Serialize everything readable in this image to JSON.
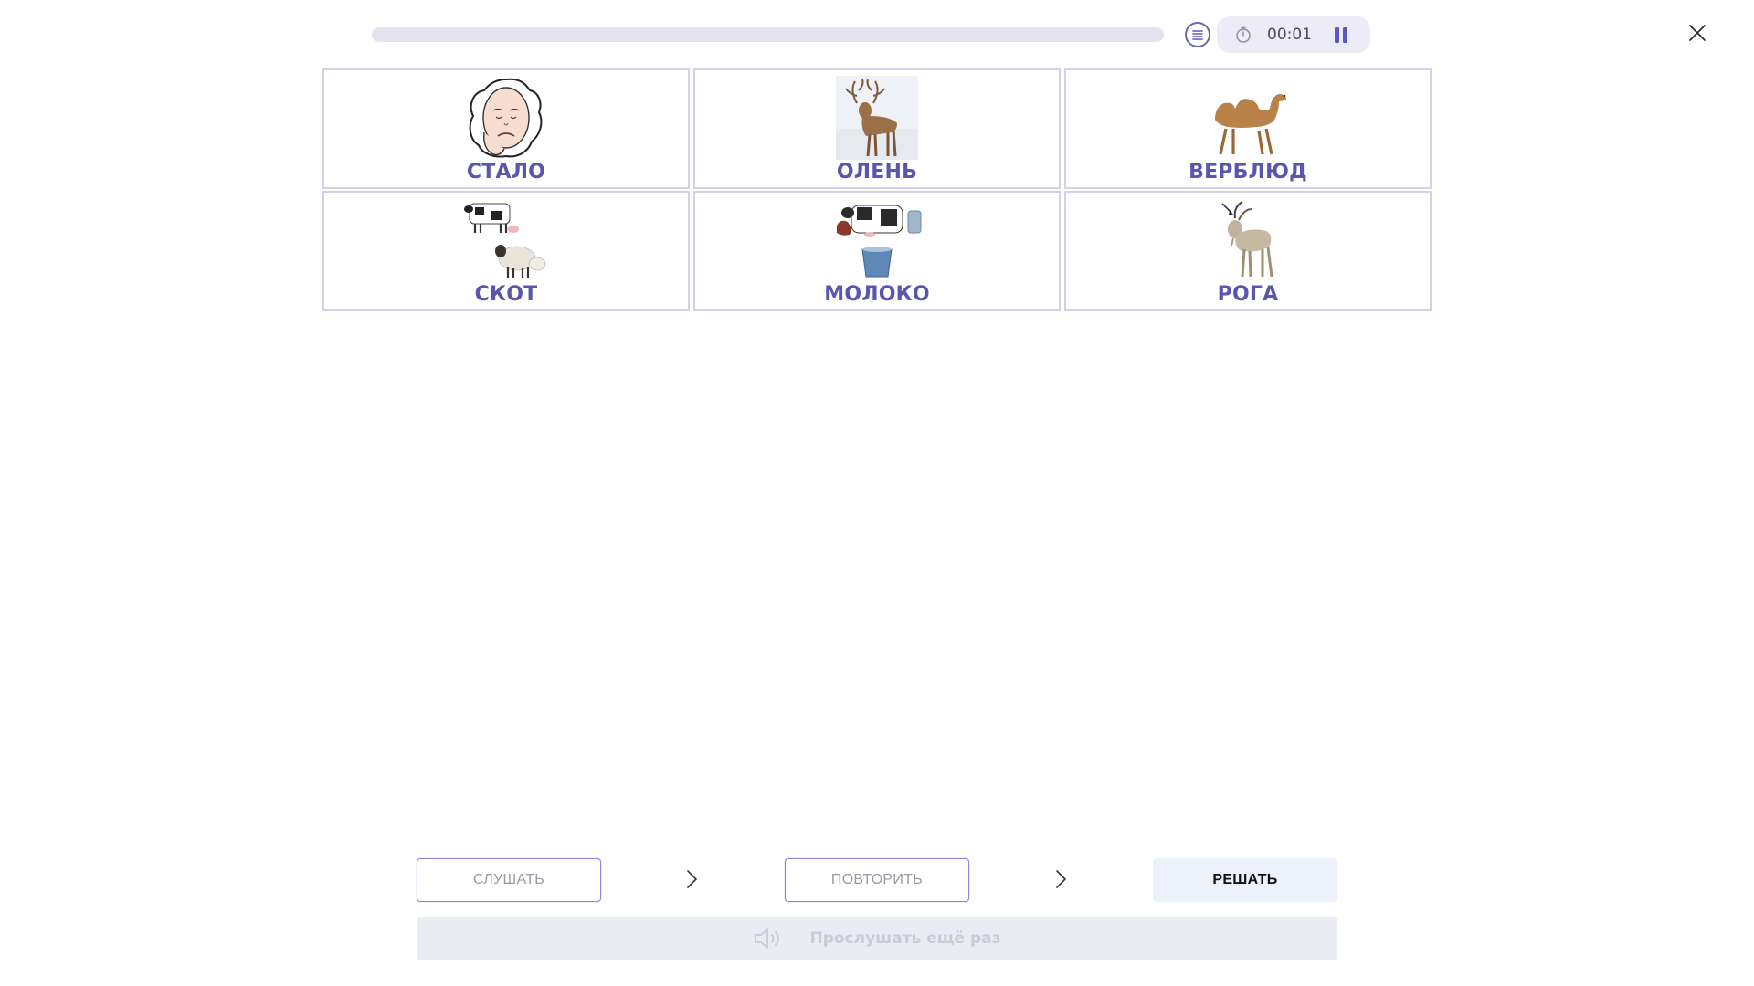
{
  "header": {
    "progress": 0,
    "timer": "00:01"
  },
  "cards": [
    {
      "label": "СТАЛО",
      "icon": "sad-face-icon"
    },
    {
      "label": "ОЛЕНЬ",
      "icon": "deer-icon"
    },
    {
      "label": "ВЕРБЛЮД",
      "icon": "camel-icon"
    },
    {
      "label": "СКОТ",
      "icon": "livestock-icon"
    },
    {
      "label": "МОЛОКО",
      "icon": "milk-icon"
    },
    {
      "label": "РОГА",
      "icon": "goat-horns-icon"
    }
  ],
  "steps": {
    "listen": "СЛУШАТЬ",
    "repeat": "ПОВТОРИТЬ",
    "solve": "РЕШАТЬ"
  },
  "replay": {
    "label": "Прослушать ещё раз",
    "icon": "speaker-icon"
  },
  "colors": {
    "accent": "#5a55ad",
    "card_border": "#d3d1ea"
  }
}
